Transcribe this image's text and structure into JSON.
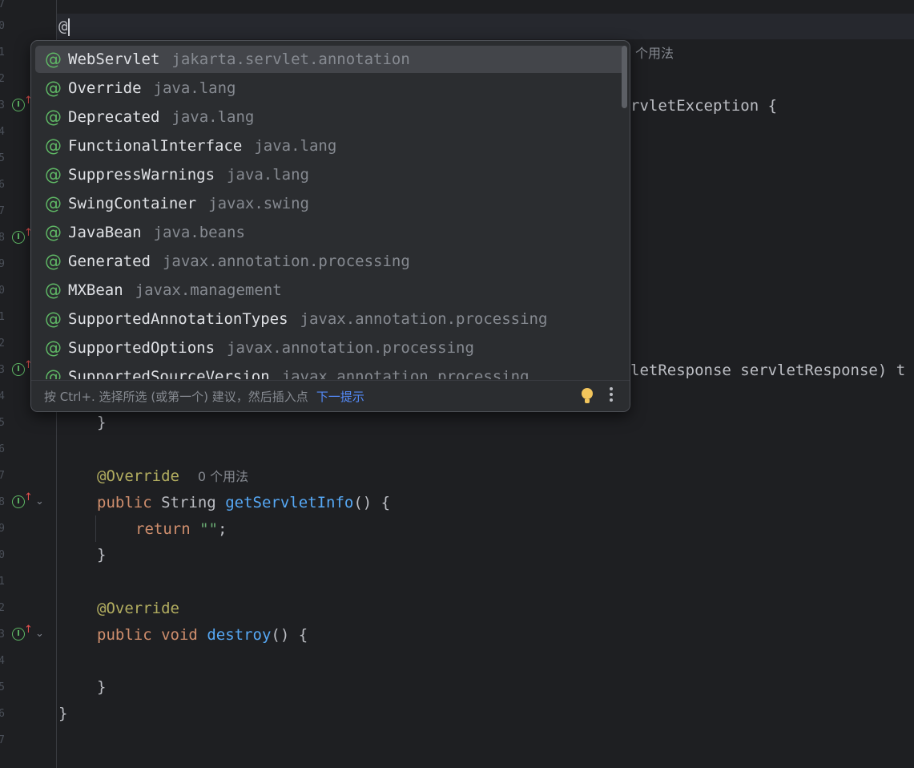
{
  "editor": {
    "line_numbers": [
      "7",
      "0",
      "1",
      "2",
      "3",
      "4",
      "5",
      "6",
      "7",
      "8",
      "9",
      "0",
      "1",
      "2",
      "3",
      "4",
      "5",
      "6",
      "7",
      "8",
      "9",
      "0",
      "1",
      "2",
      "3",
      "4",
      "5",
      "6",
      "7"
    ],
    "cursor_line_text": "@",
    "right_fragments": {
      "usage_hint": "个用法",
      "servlet_exception": "rvletException {",
      "servlet_response": "letResponse servletResponse) t"
    },
    "code": {
      "brace1": "}",
      "override1": "@Override",
      "usage1": "0 个用法",
      "public1": "public",
      "string_type": "String",
      "get_servlet_info": "getServletInfo",
      "parens_brace": "() {",
      "return_kw": "return",
      "empty_str": "\"\"",
      "semicolon": ";",
      "brace2": "}",
      "override2": "@Override",
      "public2": "public",
      "void_kw": "void",
      "destroy": "destroy",
      "parens_brace2": "() {",
      "brace3": "}",
      "brace4": "}"
    }
  },
  "completion": {
    "items": [
      {
        "name": "WebServlet",
        "package": "jakarta.servlet.annotation"
      },
      {
        "name": "Override",
        "package": "java.lang"
      },
      {
        "name": "Deprecated",
        "package": "java.lang"
      },
      {
        "name": "FunctionalInterface",
        "package": "java.lang"
      },
      {
        "name": "SuppressWarnings",
        "package": "java.lang"
      },
      {
        "name": "SwingContainer",
        "package": "javax.swing"
      },
      {
        "name": "JavaBean",
        "package": "java.beans"
      },
      {
        "name": "Generated",
        "package": "javax.annotation.processing"
      },
      {
        "name": "MXBean",
        "package": "javax.management"
      },
      {
        "name": "SupportedAnnotationTypes",
        "package": "javax.annotation.processing"
      },
      {
        "name": "SupportedOptions",
        "package": "javax.annotation.processing"
      },
      {
        "name": "SupportedSourceVersion",
        "package": "javax.annotation.processing"
      }
    ],
    "selected_index": 0,
    "item_icon": "@",
    "footer_text": "按 Ctrl+. 选择所选 (或第一个) 建议，然后插入点",
    "footer_link": "下一提示"
  },
  "icons": {
    "gutter": "implements-method-icon",
    "bulb": "lightbulb-icon",
    "more": "more-vertical-icon"
  }
}
